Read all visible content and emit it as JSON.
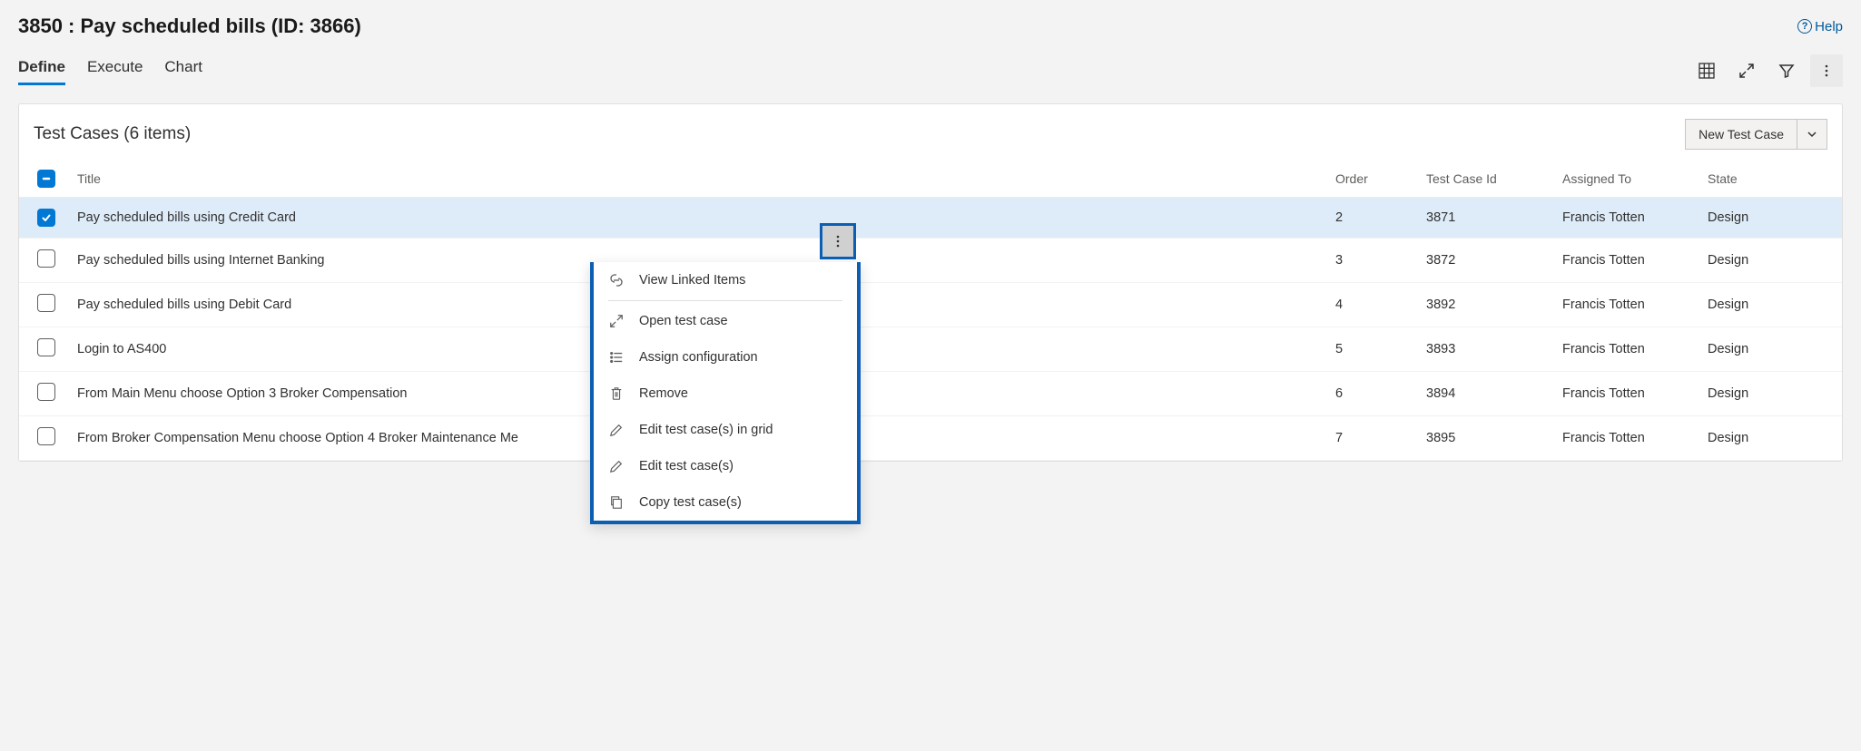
{
  "header": {
    "title": "3850 : Pay scheduled bills (ID: 3866)",
    "help_label": "Help"
  },
  "tabs": {
    "define": "Define",
    "execute": "Execute",
    "chart": "Chart"
  },
  "panel": {
    "title": "Test Cases (6 items)",
    "new_button": "New Test Case"
  },
  "columns": {
    "title": "Title",
    "order": "Order",
    "id": "Test Case Id",
    "assigned": "Assigned To",
    "state": "State"
  },
  "rows": [
    {
      "title": "Pay scheduled bills using Credit Card",
      "order": "2",
      "id": "3871",
      "assigned": "Francis Totten",
      "state": "Design",
      "selected": true
    },
    {
      "title": "Pay scheduled bills using Internet Banking",
      "order": "3",
      "id": "3872",
      "assigned": "Francis Totten",
      "state": "Design",
      "selected": false
    },
    {
      "title": "Pay scheduled bills using Debit Card",
      "order": "4",
      "id": "3892",
      "assigned": "Francis Totten",
      "state": "Design",
      "selected": false
    },
    {
      "title": "Login to AS400",
      "order": "5",
      "id": "3893",
      "assigned": "Francis Totten",
      "state": "Design",
      "selected": false
    },
    {
      "title": "From Main Menu choose Option 3 Broker Compensation",
      "order": "6",
      "id": "3894",
      "assigned": "Francis Totten",
      "state": "Design",
      "selected": false
    },
    {
      "title": "From Broker Compensation Menu choose Option 4 Broker Maintenance Me",
      "order": "7",
      "id": "3895",
      "assigned": "Francis Totten",
      "state": "Design",
      "selected": false
    }
  ],
  "menu": {
    "view_linked": "View Linked Items",
    "open": "Open test case",
    "assign": "Assign configuration",
    "remove": "Remove",
    "edit_grid": "Edit test case(s) in grid",
    "edit": "Edit test case(s)",
    "copy": "Copy test case(s)"
  }
}
